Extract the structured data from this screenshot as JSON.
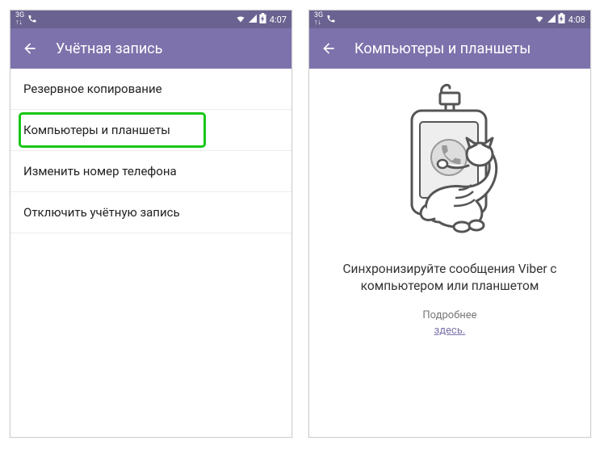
{
  "colors": {
    "accent": "#7d72ac",
    "status": "#6a6290",
    "highlight": "#18c716"
  },
  "screens": {
    "left": {
      "status": {
        "time": "4:07"
      },
      "appbar": {
        "title": "Учётная запись"
      },
      "list": [
        {
          "label": "Резервное копирование"
        },
        {
          "label": "Компьютеры и планшеты",
          "highlighted": true
        },
        {
          "label": "Изменить номер телефона"
        },
        {
          "label": "Отключить учётную запись"
        }
      ]
    },
    "right": {
      "status": {
        "time": "4:08"
      },
      "appbar": {
        "title": "Компьютеры и планшеты"
      },
      "sync_message": "Синхронизируйте сообщения Viber с компьютером или планшетом",
      "more_label": "Подробнее",
      "more_link": "здесь."
    }
  }
}
